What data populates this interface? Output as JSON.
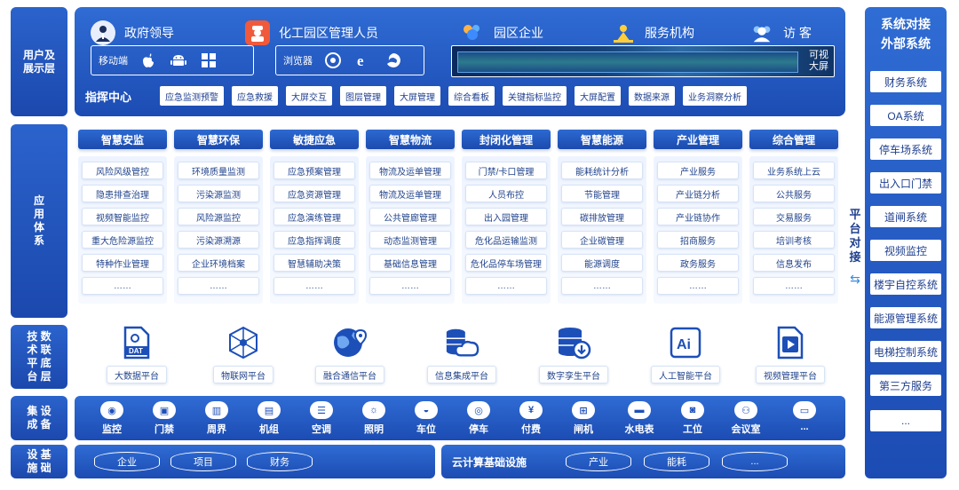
{
  "layers": {
    "user": "用户及\n展示层",
    "app": "应\n用\n体\n系",
    "tech": "技 数\n术 联\n平 底\n台 层",
    "device": "集 设\n成 备",
    "infra": "设 基\n施 础"
  },
  "users": [
    {
      "label": "政府领导",
      "icon": "official-icon"
    },
    {
      "label": "化工园区管理人员",
      "icon": "worker-icon"
    },
    {
      "label": "园区企业",
      "icon": "enterprise-icon"
    },
    {
      "label": "服务机构",
      "icon": "service-icon"
    },
    {
      "label": "访  客",
      "icon": "visitor-icon"
    }
  ],
  "terminals": {
    "mobile_label": "移动端",
    "browser_label": "浏览器",
    "big_screen_label": "可视\n大屏"
  },
  "command_center": {
    "title": "指挥中心",
    "items": [
      "应急监测预警",
      "应急救援",
      "大屏交互",
      "图层管理",
      "大屏管理",
      "综合看板",
      "关键指标监控",
      "大屏配置",
      "数据来源",
      "业务洞察分析"
    ]
  },
  "apps": [
    {
      "title": "智慧安监",
      "items": [
        "风险风级管控",
        "隐患排查治理",
        "视频智能监控",
        "重大危险源监控",
        "特种作业管理",
        "……"
      ]
    },
    {
      "title": "智慧环保",
      "items": [
        "环境质量监测",
        "污染源监测",
        "风险源监控",
        "污染源溯源",
        "企业环境档案",
        "……"
      ]
    },
    {
      "title": "敏捷应急",
      "items": [
        "应急预案管理",
        "应急资源管理",
        "应急演练管理",
        "应急指挥调度",
        "智慧辅助决策",
        "……"
      ]
    },
    {
      "title": "智慧物流",
      "items": [
        "物流及运单管理",
        "物流及运单管理",
        "公共管廊管理",
        "动态监测管理",
        "基础信息管理",
        "……"
      ]
    },
    {
      "title": "封闭化管理",
      "items": [
        "门禁/卡口管理",
        "人员布控",
        "出入园管理",
        "危化品运输监测",
        "危化品停车场管理",
        "……"
      ]
    },
    {
      "title": "智慧能源",
      "items": [
        "能耗统计分析",
        "节能管理",
        "碳排放管理",
        "企业碳管理",
        "能源调度",
        "……"
      ]
    },
    {
      "title": "产业管理",
      "items": [
        "产业服务",
        "产业链分析",
        "产业链协作",
        "招商服务",
        "政务服务",
        "……"
      ]
    },
    {
      "title": "综合管理",
      "items": [
        "业务系统上云",
        "公共服务",
        "交易服务",
        "培训考核",
        "信息发布",
        "……"
      ]
    }
  ],
  "platforms": [
    {
      "label": "大数据平台",
      "icon": "dat-file-icon"
    },
    {
      "label": "物联网平台",
      "icon": "iot-network-icon"
    },
    {
      "label": "融合通信平台",
      "icon": "globe-location-icon"
    },
    {
      "label": "信息集成平台",
      "icon": "database-cloud-icon"
    },
    {
      "label": "数字孪生平台",
      "icon": "database-download-icon"
    },
    {
      "label": "人工智能平台",
      "icon": "ai-icon"
    },
    {
      "label": "视频管理平台",
      "icon": "video-file-icon"
    }
  ],
  "devices": [
    "监控",
    "门禁",
    "周界",
    "机组",
    "空调",
    "照明",
    "车位",
    "停车",
    "付费",
    "闸机",
    "水电表",
    "工位",
    "会议室",
    "..."
  ],
  "infra": {
    "left": [
      "企业",
      "项目",
      "财务"
    ],
    "cloud_title": "云计算基础设施",
    "right": [
      "产业",
      "能耗",
      "..."
    ]
  },
  "external": {
    "title": "系统对接\n外部系统",
    "items": [
      "财务系统",
      "OA系统",
      "停车场系统",
      "出入口门禁",
      "道闸系统",
      "视频监控",
      "楼宇自控系统",
      "能源管理系统",
      "电梯控制系统",
      "第三方服务",
      "..."
    ]
  },
  "platform_dock": "平\n台\n对\n接",
  "colors": {
    "primary": "#1d4fb8",
    "accent": "#2f6cd4",
    "text": "#1f3f8f"
  }
}
